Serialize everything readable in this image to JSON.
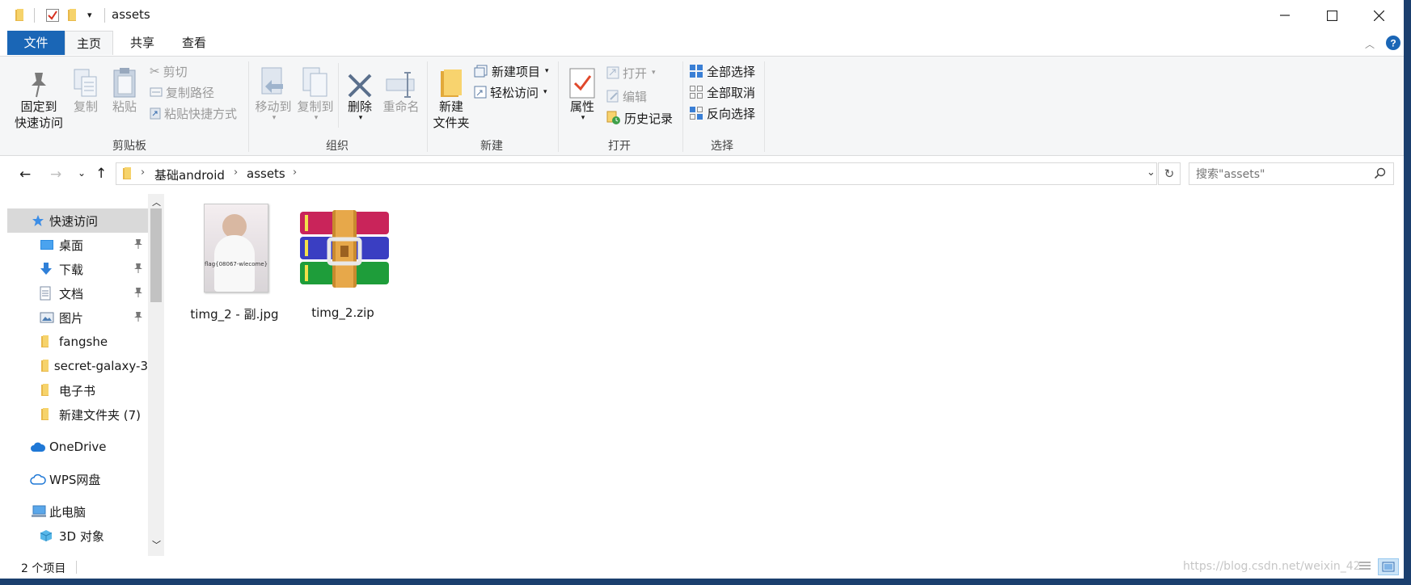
{
  "window": {
    "title": "assets"
  },
  "tabs": {
    "file": "文件",
    "home": "主页",
    "share": "共享",
    "view": "查看"
  },
  "ribbon": {
    "clipboard": {
      "label": "剪贴板",
      "pin_line1": "固定到",
      "pin_line2": "快速访问",
      "copy": "复制",
      "paste": "粘贴",
      "cut": "剪切",
      "copy_path": "复制路径",
      "paste_shortcut": "粘贴快捷方式"
    },
    "organize": {
      "label": "组织",
      "move_to": "移动到",
      "copy_to": "复制到",
      "delete": "删除",
      "rename": "重命名"
    },
    "new": {
      "label": "新建",
      "new_folder_line1": "新建",
      "new_folder_line2": "文件夹",
      "new_item": "新建项目",
      "easy_access": "轻松访问"
    },
    "open": {
      "label": "打开",
      "properties": "属性",
      "open": "打开",
      "edit": "编辑",
      "history": "历史记录"
    },
    "select": {
      "label": "选择",
      "select_all": "全部选择",
      "select_none": "全部取消",
      "invert": "反向选择"
    }
  },
  "address": {
    "crumbs": [
      "基础android",
      "assets"
    ],
    "search_placeholder": "搜索\"assets\""
  },
  "nav": {
    "quick_access": "快速访问",
    "items": [
      {
        "label": "桌面",
        "pinned": true
      },
      {
        "label": "下载",
        "pinned": true
      },
      {
        "label": "文档",
        "pinned": true
      },
      {
        "label": "图片",
        "pinned": true
      },
      {
        "label": "fangshe",
        "pinned": false
      },
      {
        "label": "secret-galaxy-3",
        "pinned": false
      },
      {
        "label": "电子书",
        "pinned": false
      },
      {
        "label": "新建文件夹 (7)",
        "pinned": false
      }
    ],
    "onedrive": "OneDrive",
    "wps": "WPS网盘",
    "this_pc": "此电脑",
    "objects_3d": "3D 对象"
  },
  "files": [
    {
      "name": "timg_2 - 副.jpg",
      "thumb_caption": "flag{08067-wlecome}",
      "type": "image"
    },
    {
      "name": "timg_2.zip",
      "type": "archive"
    }
  ],
  "status": {
    "count": "2 个项目"
  },
  "watermark": "https://blog.csdn.net/weixin_42"
}
